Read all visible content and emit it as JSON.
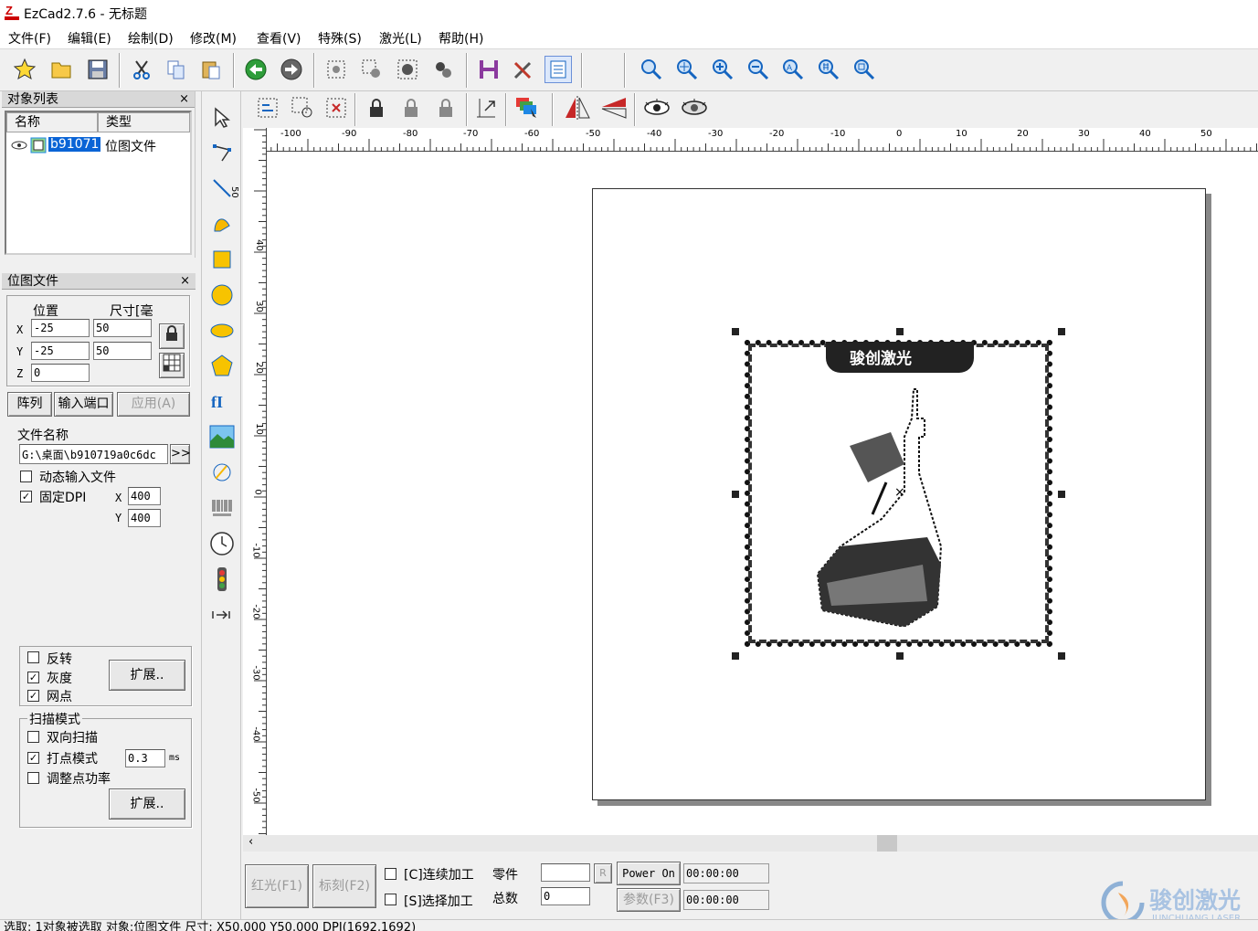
{
  "window": {
    "title": "EzCad2.7.6 - 无标题"
  },
  "menu": [
    "文件(F)",
    "编辑(E)",
    "绘制(D)",
    "修改(M)",
    "查看(V)",
    "特殊(S)",
    "激光(L)",
    "帮助(H)"
  ],
  "object_list": {
    "title": "对象列表",
    "col_name": "名称",
    "col_type": "类型",
    "row": {
      "name": "b91071",
      "type": "位图文件"
    }
  },
  "props": {
    "title": "位图文件",
    "pos_label": "位置",
    "size_label": "尺寸[毫",
    "x_label": "X",
    "y_label": "Y",
    "z_label": "Z",
    "x_pos": "-25",
    "y_pos": "-25",
    "z_pos": "0",
    "x_size": "50",
    "y_size": "50",
    "array_btn": "阵列",
    "input_port_btn": "输入端口",
    "apply_btn": "应用(A)",
    "file_name_label": "文件名称",
    "file_path": "G:\\桌面\\b910719a0c6dc",
    "browse_btn": ">>",
    "dynamic_input": "动态输入文件",
    "fixed_dpi": "固定DPI",
    "dpi_x_label": "X",
    "dpi_y_label": "Y",
    "dpi_x": "400",
    "dpi_y": "400",
    "invert": "反转",
    "grayscale": "灰度",
    "dither": "网点",
    "expand1": "扩展..",
    "scan_mode": "扫描模式",
    "bidir": "双向扫描",
    "dot_mode": "打点模式",
    "dot_time": "0.3",
    "dot_unit": "ms",
    "adjust_power": "调整点功率",
    "expand2": "扩展.."
  },
  "ruler": {
    "h_labels": [
      "-100",
      "-90",
      "-80",
      "-70",
      "-60",
      "-50",
      "-40",
      "-30",
      "-20",
      "-10",
      "0",
      "10",
      "20",
      "30",
      "40",
      "50"
    ],
    "v_labels": [
      "50",
      "40",
      "30",
      "20",
      "10",
      "0",
      "-10",
      "-20",
      "-30",
      "-40",
      "-50"
    ]
  },
  "canvas": {
    "logo_text": "骏创激光"
  },
  "bottom": {
    "red_light_btn": "红光(F1)",
    "mark_btn": "标刻(F2)",
    "continuous": "[C]连续加工",
    "select_proc": "[S]选择加工",
    "parts_label": "零件",
    "total_label": "总数",
    "parts_value": "",
    "total_value": "0",
    "r_btn": "R",
    "power_btn": "Power On",
    "param_btn": "参数(F3)",
    "time1": "00:00:00",
    "time2": "00:00:00"
  },
  "watermark": {
    "cn": "骏创激光",
    "en": "JUNCHUANG LASER"
  },
  "status": "选取: 1对象被选取 对象:位图文件 尺寸: X50.000 Y50.000 DPI(1692,1692)"
}
